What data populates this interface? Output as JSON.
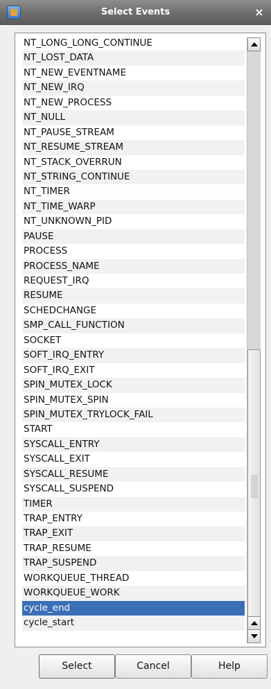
{
  "window": {
    "title": "Select Events",
    "close_glyph": "×",
    "icon": "app-icon"
  },
  "list": {
    "items": [
      "NT_LONG_LONG_CONTINUE",
      "NT_LOST_DATA",
      "NT_NEW_EVENTNAME",
      "NT_NEW_IRQ",
      "NT_NEW_PROCESS",
      "NT_NULL",
      "NT_PAUSE_STREAM",
      "NT_RESUME_STREAM",
      "NT_STACK_OVERRUN",
      "NT_STRING_CONTINUE",
      "NT_TIMER",
      "NT_TIME_WARP",
      "NT_UNKNOWN_PID",
      "PAUSE",
      "PROCESS",
      "PROCESS_NAME",
      "REQUEST_IRQ",
      "RESUME",
      "SCHEDCHANGE",
      "SMP_CALL_FUNCTION",
      "SOCKET",
      "SOFT_IRQ_ENTRY",
      "SOFT_IRQ_EXIT",
      "SPIN_MUTEX_LOCK",
      "SPIN_MUTEX_SPIN",
      "SPIN_MUTEX_TRYLOCK_FAIL",
      "START",
      "SYSCALL_ENTRY",
      "SYSCALL_EXIT",
      "SYSCALL_RESUME",
      "SYSCALL_SUSPEND",
      "TIMER",
      "TRAP_ENTRY",
      "TRAP_EXIT",
      "TRAP_RESUME",
      "TRAP_SUSPEND",
      "WORKQUEUE_THREAD",
      "WORKQUEUE_WORK",
      "cycle_end",
      "cycle_start"
    ],
    "selected": "cycle_end"
  },
  "buttons": {
    "select_label": "Select",
    "cancel_label": "Cancel",
    "help_label": "Help"
  },
  "colors": {
    "selection": "#3b6fb6",
    "titlebar": "#6f6f6f"
  }
}
